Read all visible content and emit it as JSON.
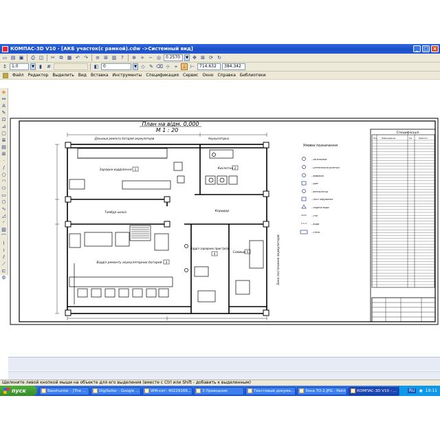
{
  "window": {
    "title": "КОМПАС-3D V10 - [АКБ участок(с рамкой).cdw ->Системный вид]"
  },
  "toolbar": {
    "zoom_value": "0.2570",
    "scale_value": "1.0",
    "layer_value": "0",
    "coord_x": "714.632",
    "coord_y": "384.342"
  },
  "menu": {
    "items": [
      "Файл",
      "Редактор",
      "Выделить",
      "Вид",
      "Вставка",
      "Инструменты",
      "Спецификация",
      "Сервис",
      "Окно",
      "Справка",
      "Библиотеки"
    ]
  },
  "drawing": {
    "title": "План на відм. 0,000",
    "scale": "М 1 : 20",
    "room_top_left": "Дільниця ремонту батарей акумуляторів",
    "room_top_right": "Акумуляторна",
    "room_storage": "Зарядне відділення",
    "room_storage_num": "1",
    "room_acid": "Кислотна",
    "room_acid_num": "2",
    "room_corridor_left": "Тамбур-шлюз",
    "room_corridor": "Коридор",
    "room_bottom_main": "Відділ ремонту акумуляторних батарей",
    "room_bottom_main_num": "3",
    "room_charge": "Відділ зарядних пристроїв",
    "room_charge_num": "4",
    "room_right": "Сховище",
    "room_right_num": "5",
    "vertical_label": "Зона постачання акумуляторів",
    "legend_title": "Умовні позначення",
    "legend_items": [
      "- світильник",
      "- штепсельна розетка",
      "- вимикач",
      "- щит",
      "- вентилятор",
      "- пост керування",
      "- подача води",
      "- стік",
      "- вода",
      "- стіна"
    ],
    "spec_title": "Специфікація",
    "spec_headers": [
      "Поз.",
      "Найменування",
      "Кіл.",
      "Примітка"
    ]
  },
  "status": {
    "hint": "Щелкните левой кнопкой мыши на объекте для его выделения (вместе с Ctrl или Shift - добавить к выделенным)"
  },
  "taskbar": {
    "start_label": "пуск",
    "tasks": [
      "Basshunter - [The ...",
      "DigiSeller - Google ...",
      "WM-кит: 40229166...",
      "3 Проводник",
      "Текстовый докуме...",
      "Зона ТО-2.JPG - Paint",
      "КОМПАС-3D V10 - ..."
    ],
    "lang": "RU",
    "clock": "19:11"
  }
}
